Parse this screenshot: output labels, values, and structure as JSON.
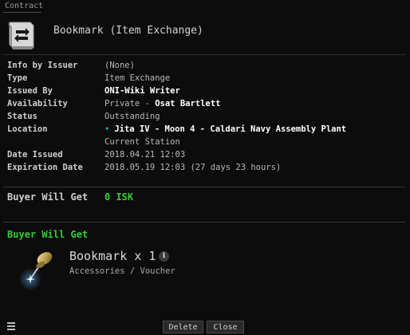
{
  "window": {
    "title": "Contract"
  },
  "contract": {
    "title": "Bookmark (Item Exchange)"
  },
  "info": [
    {
      "label": "Info by Issuer",
      "value": "(None)"
    },
    {
      "label": "Type",
      "value": "Item Exchange"
    },
    {
      "label": "Issued By",
      "value": "ONI-Wiki Writer"
    },
    {
      "label": "Availability",
      "value_prefix": "Private - ",
      "value_strong": "Osat Bartlett"
    },
    {
      "label": "Status",
      "value": "Outstanding"
    },
    {
      "label": "Location",
      "value": "Jita IV - Moon 4 - Caldari Navy Assembly Plant",
      "subvalue": "Current Station"
    },
    {
      "label": "Date Issued",
      "value": "2018.04.21 12:03"
    },
    {
      "label": "Expiration Date",
      "value": "2018.05.19 12:03 (27 days 23 hours)"
    }
  ],
  "buyer_summary": {
    "label": "Buyer Will Get",
    "value": "0 ISK"
  },
  "buyer_section": {
    "title": "Buyer Will Get"
  },
  "item": {
    "name": "Bookmark x 1",
    "category": "Accessories / Voucher",
    "info_glyph": "i",
    "icon": "bookmark-pin-icon"
  },
  "buttons": {
    "delete": "Delete",
    "close": "Close"
  },
  "colors": {
    "accent_green": "#32cd32",
    "isk_green": "#2fd02f",
    "background": "#0c0c0c"
  }
}
